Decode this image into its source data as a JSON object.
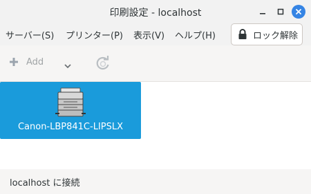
{
  "window": {
    "title": "印刷設定 - localhost"
  },
  "menubar": {
    "items": [
      {
        "label": "サーバー(S)"
      },
      {
        "label": "プリンター(P)"
      },
      {
        "label": "表示(V)"
      },
      {
        "label": "ヘルプ(H)"
      }
    ],
    "lock_label": "ロック解除"
  },
  "toolbar": {
    "add_label": "Add"
  },
  "printers": [
    {
      "name": "Canon-LBP841C-LIPSLX",
      "selected": true
    }
  ],
  "status": {
    "text": "localhost に接続"
  },
  "colors": {
    "selection": "#1a9bdb",
    "close_button": "#3584e4"
  }
}
